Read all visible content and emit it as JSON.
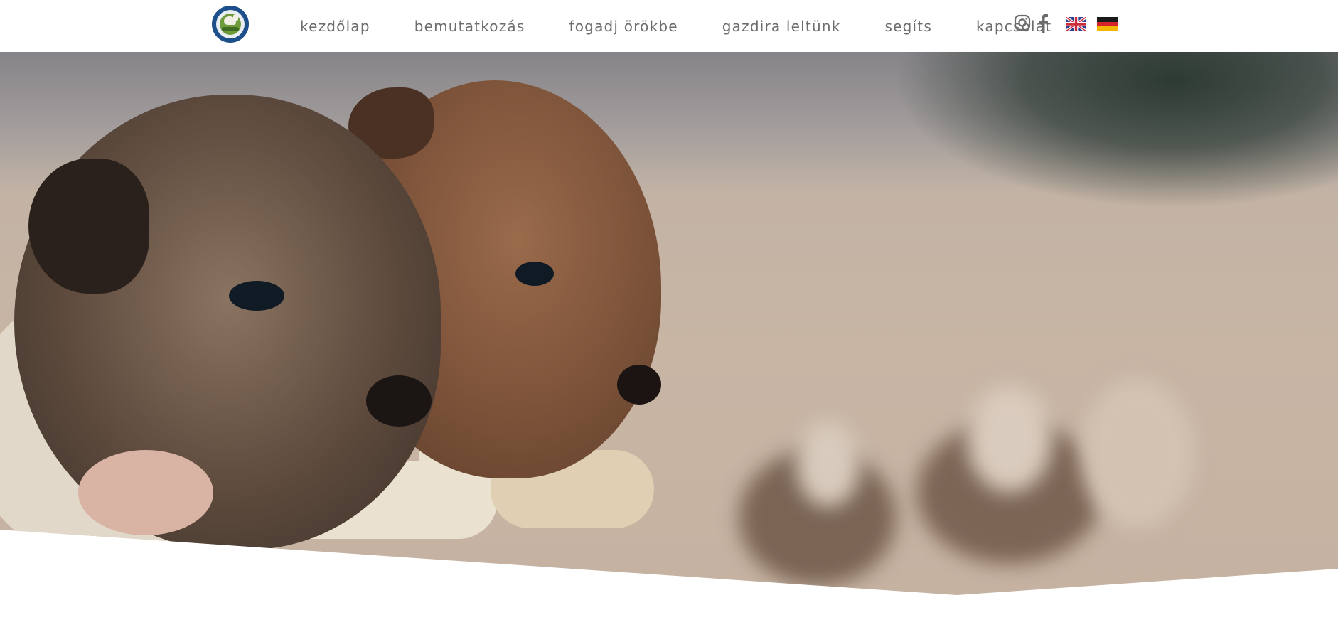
{
  "header": {
    "logo_icon": "paw-horse-rescue-logo",
    "nav": [
      {
        "label": "Kezdőlap"
      },
      {
        "label": "Bemutatkozás"
      },
      {
        "label": "Fogadj örökbe"
      },
      {
        "label": "Gazdira leltünk"
      },
      {
        "label": "Segíts"
      },
      {
        "label": "Kapcsolat"
      }
    ],
    "social_icons": [
      "instagram-icon",
      "facebook-icon"
    ],
    "language_flags": [
      "uk-flag-icon",
      "germany-flag-icon"
    ]
  },
  "hero": {
    "image": "two-puppies-held-in-gloved-hands"
  },
  "colors": {
    "nav_text": "#6d6d6d",
    "background": "#ffffff",
    "hero_tone": "#c8b5a4"
  }
}
